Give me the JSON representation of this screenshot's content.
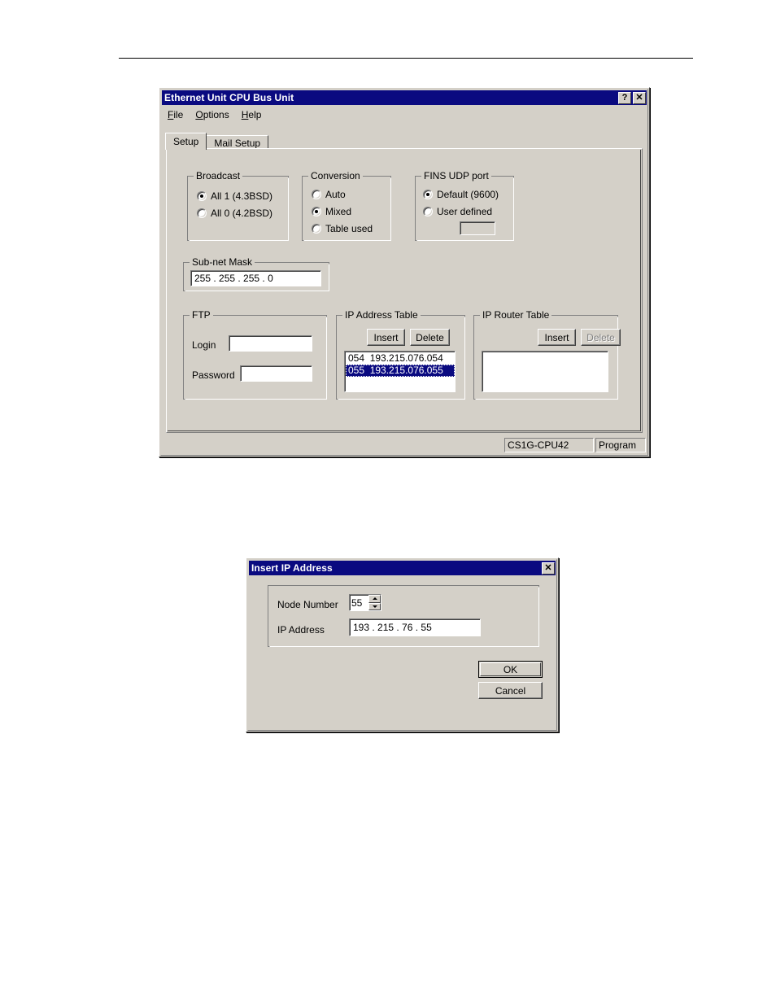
{
  "main_window": {
    "title": "Ethernet Unit CPU Bus Unit",
    "titlebar_buttons": [
      {
        "name": "help-button",
        "glyph": "?"
      },
      {
        "name": "close-button",
        "glyph": "✕"
      }
    ],
    "menu": [
      {
        "label": "File",
        "mnemonic": "F",
        "rest": "ile"
      },
      {
        "label": "Options",
        "mnemonic": "O",
        "rest": "ptions"
      },
      {
        "label": "Help",
        "mnemonic": "H",
        "rest": "elp"
      }
    ],
    "tabs": [
      {
        "label": "Setup",
        "active": true
      },
      {
        "label": "Mail Setup",
        "active": false
      }
    ],
    "broadcast": {
      "title": "Broadcast",
      "options": [
        {
          "label": "All 1 (4.3BSD)",
          "selected": true
        },
        {
          "label": "All 0 (4.2BSD)",
          "selected": false
        }
      ]
    },
    "conversion": {
      "title": "Conversion",
      "options": [
        {
          "label": "Auto",
          "selected": false
        },
        {
          "label": "Mixed",
          "selected": true
        },
        {
          "label": "Table used",
          "selected": false
        }
      ]
    },
    "fins_udp_port": {
      "title": "FINS UDP port",
      "options": [
        {
          "label": "Default (9600)",
          "selected": true
        },
        {
          "label": "User defined",
          "selected": false
        }
      ],
      "user_defined_value": ""
    },
    "subnet_mask": {
      "title": "Sub-net Mask",
      "value": "255  .  255  .  255  .    0"
    },
    "ftp": {
      "title": "FTP",
      "login_label": "Login",
      "login_value": "",
      "password_label": "Password",
      "password_value": ""
    },
    "ip_address_table": {
      "title": "IP Address Table",
      "insert_label": "Insert",
      "delete_label": "Delete",
      "insert_enabled": true,
      "delete_enabled": true,
      "items": [
        {
          "text": "054  193.215.076.054",
          "selected": false
        },
        {
          "text": "055  193.215.076.055",
          "selected": true
        }
      ]
    },
    "ip_router_table": {
      "title": "IP Router Table",
      "insert_label": "Insert",
      "delete_label": "Delete",
      "insert_enabled": true,
      "delete_enabled": false,
      "items": []
    },
    "statusbar": {
      "cpu": "CS1G-CPU42",
      "mode": "Program"
    }
  },
  "insert_dialog": {
    "title": "Insert IP Address",
    "close_glyph": "✕",
    "node_number_label": "Node Number",
    "node_number_value": "55",
    "ip_address_label": "IP Address",
    "ip_address_value": "193  .  215  .   76  .   55",
    "ok_label": "OK",
    "cancel_label": "Cancel"
  },
  "colors": {
    "titlebar": "#0a0a80",
    "face": "#d4d0c8",
    "selection": "#0a0a80",
    "disabled_text": "#808080"
  }
}
